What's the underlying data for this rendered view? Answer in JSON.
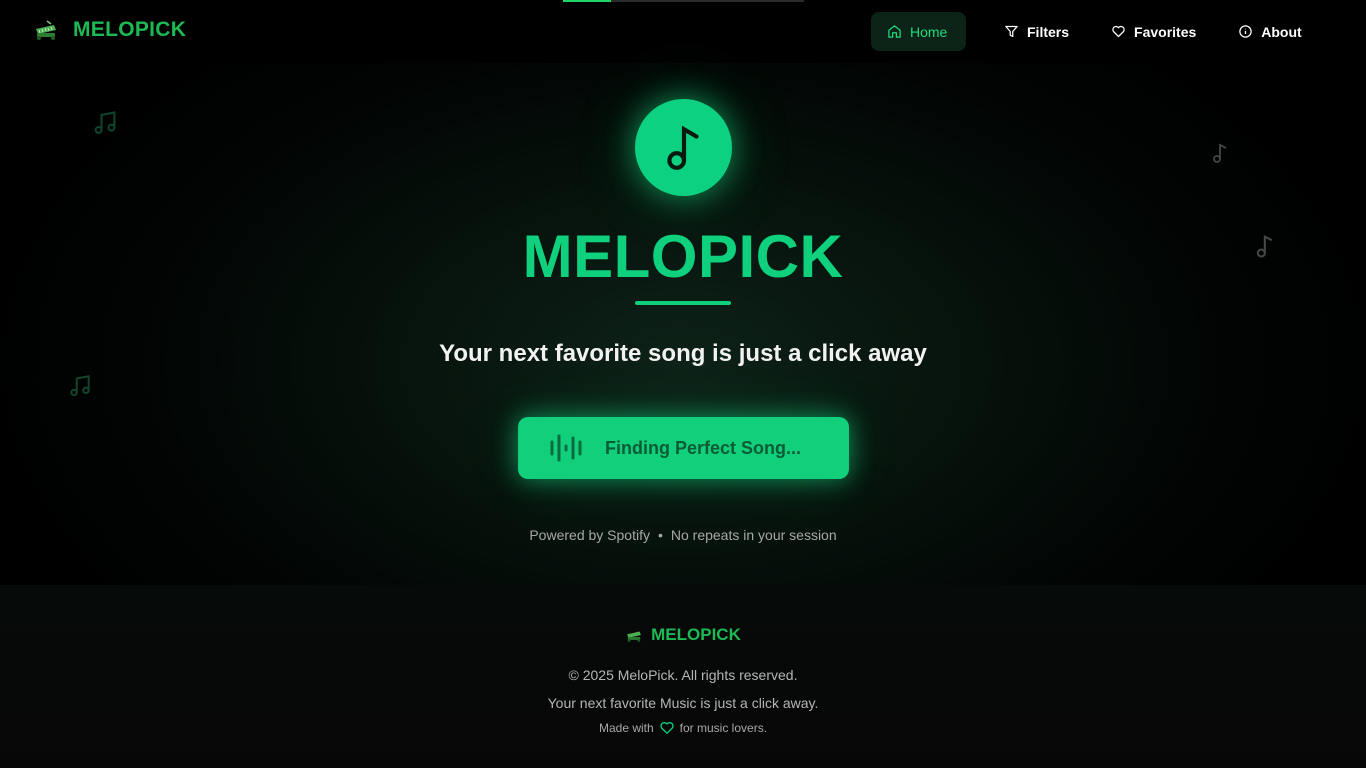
{
  "header": {
    "brand_name": "MELOPICK",
    "logo_icon": "piano-icon",
    "nav": [
      {
        "label": "Home",
        "icon": "home-icon",
        "active": true
      },
      {
        "label": "Filters",
        "icon": "filter-icon",
        "active": false
      },
      {
        "label": "Favorites",
        "icon": "heart-icon",
        "active": false
      },
      {
        "label": "About",
        "icon": "info-icon",
        "active": false
      }
    ]
  },
  "hero": {
    "icon": "music-note-icon",
    "title": "MELOPICK",
    "subtitle": "Your next favorite song is just a click away",
    "cta_label": "Finding Perfect Song...",
    "cta_icon": "audio-wave-icon",
    "meta_left": "Powered by Spotify",
    "meta_separator": "•",
    "meta_right": "No repeats in your session"
  },
  "footer": {
    "brand_name": "MELOPICK",
    "copyright": "© 2025 MeloPick. All rights reserved.",
    "tagline": "Your next favorite Music is just a click away.",
    "made_prefix": "Made with",
    "made_suffix": "for music lovers."
  },
  "colors": {
    "accent": "#0ed07d",
    "brand": "#1db954",
    "background": "#000000"
  }
}
